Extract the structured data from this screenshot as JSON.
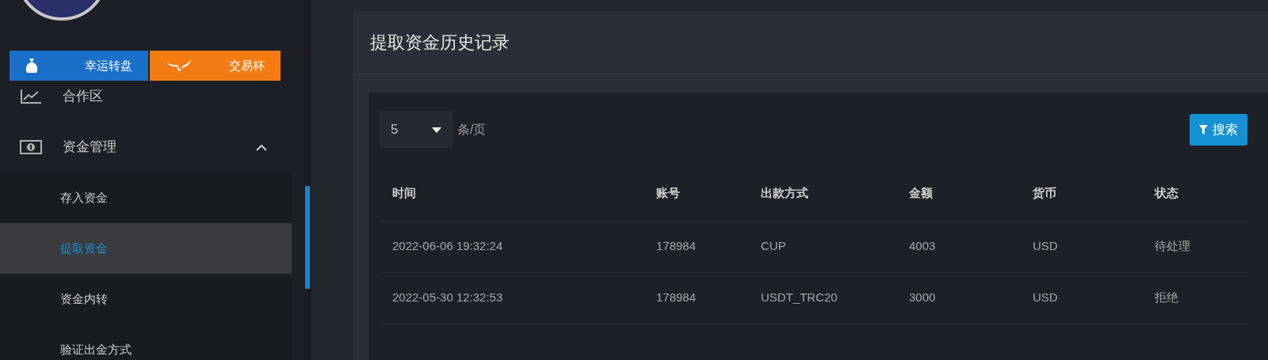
{
  "sidebar": {
    "promo_buttons": [
      {
        "label": "幸运转盘",
        "kind": "wheel"
      },
      {
        "label": "交易杯",
        "kind": "cup"
      }
    ],
    "items": [
      {
        "label": "合作区",
        "kind": "chart",
        "selected": false
      },
      {
        "label": "资金管理",
        "kind": "money",
        "expanded": true,
        "selected": false,
        "children": [
          {
            "label": "存入资金",
            "selected": false
          },
          {
            "label": "提取资金",
            "selected": true
          },
          {
            "label": "资金内转",
            "selected": false
          },
          {
            "label": "验证出金方式",
            "selected": false
          }
        ]
      }
    ]
  },
  "panel": {
    "title": "提取资金历史记录",
    "page_size": {
      "value": "5",
      "suffix": "条/页"
    },
    "search_button": "搜索",
    "table": {
      "columns": [
        "时间",
        "账号",
        "出款方式",
        "金额",
        "货币",
        "状态"
      ],
      "rows": [
        [
          "2022-06-06 19:32:24",
          "178984",
          "CUP",
          "4003",
          "USD",
          "待处理"
        ],
        [
          "2022-05-30 12:32:53",
          "178984",
          "USDT_TRC20",
          "3000",
          "USD",
          "拒绝"
        ]
      ]
    }
  }
}
